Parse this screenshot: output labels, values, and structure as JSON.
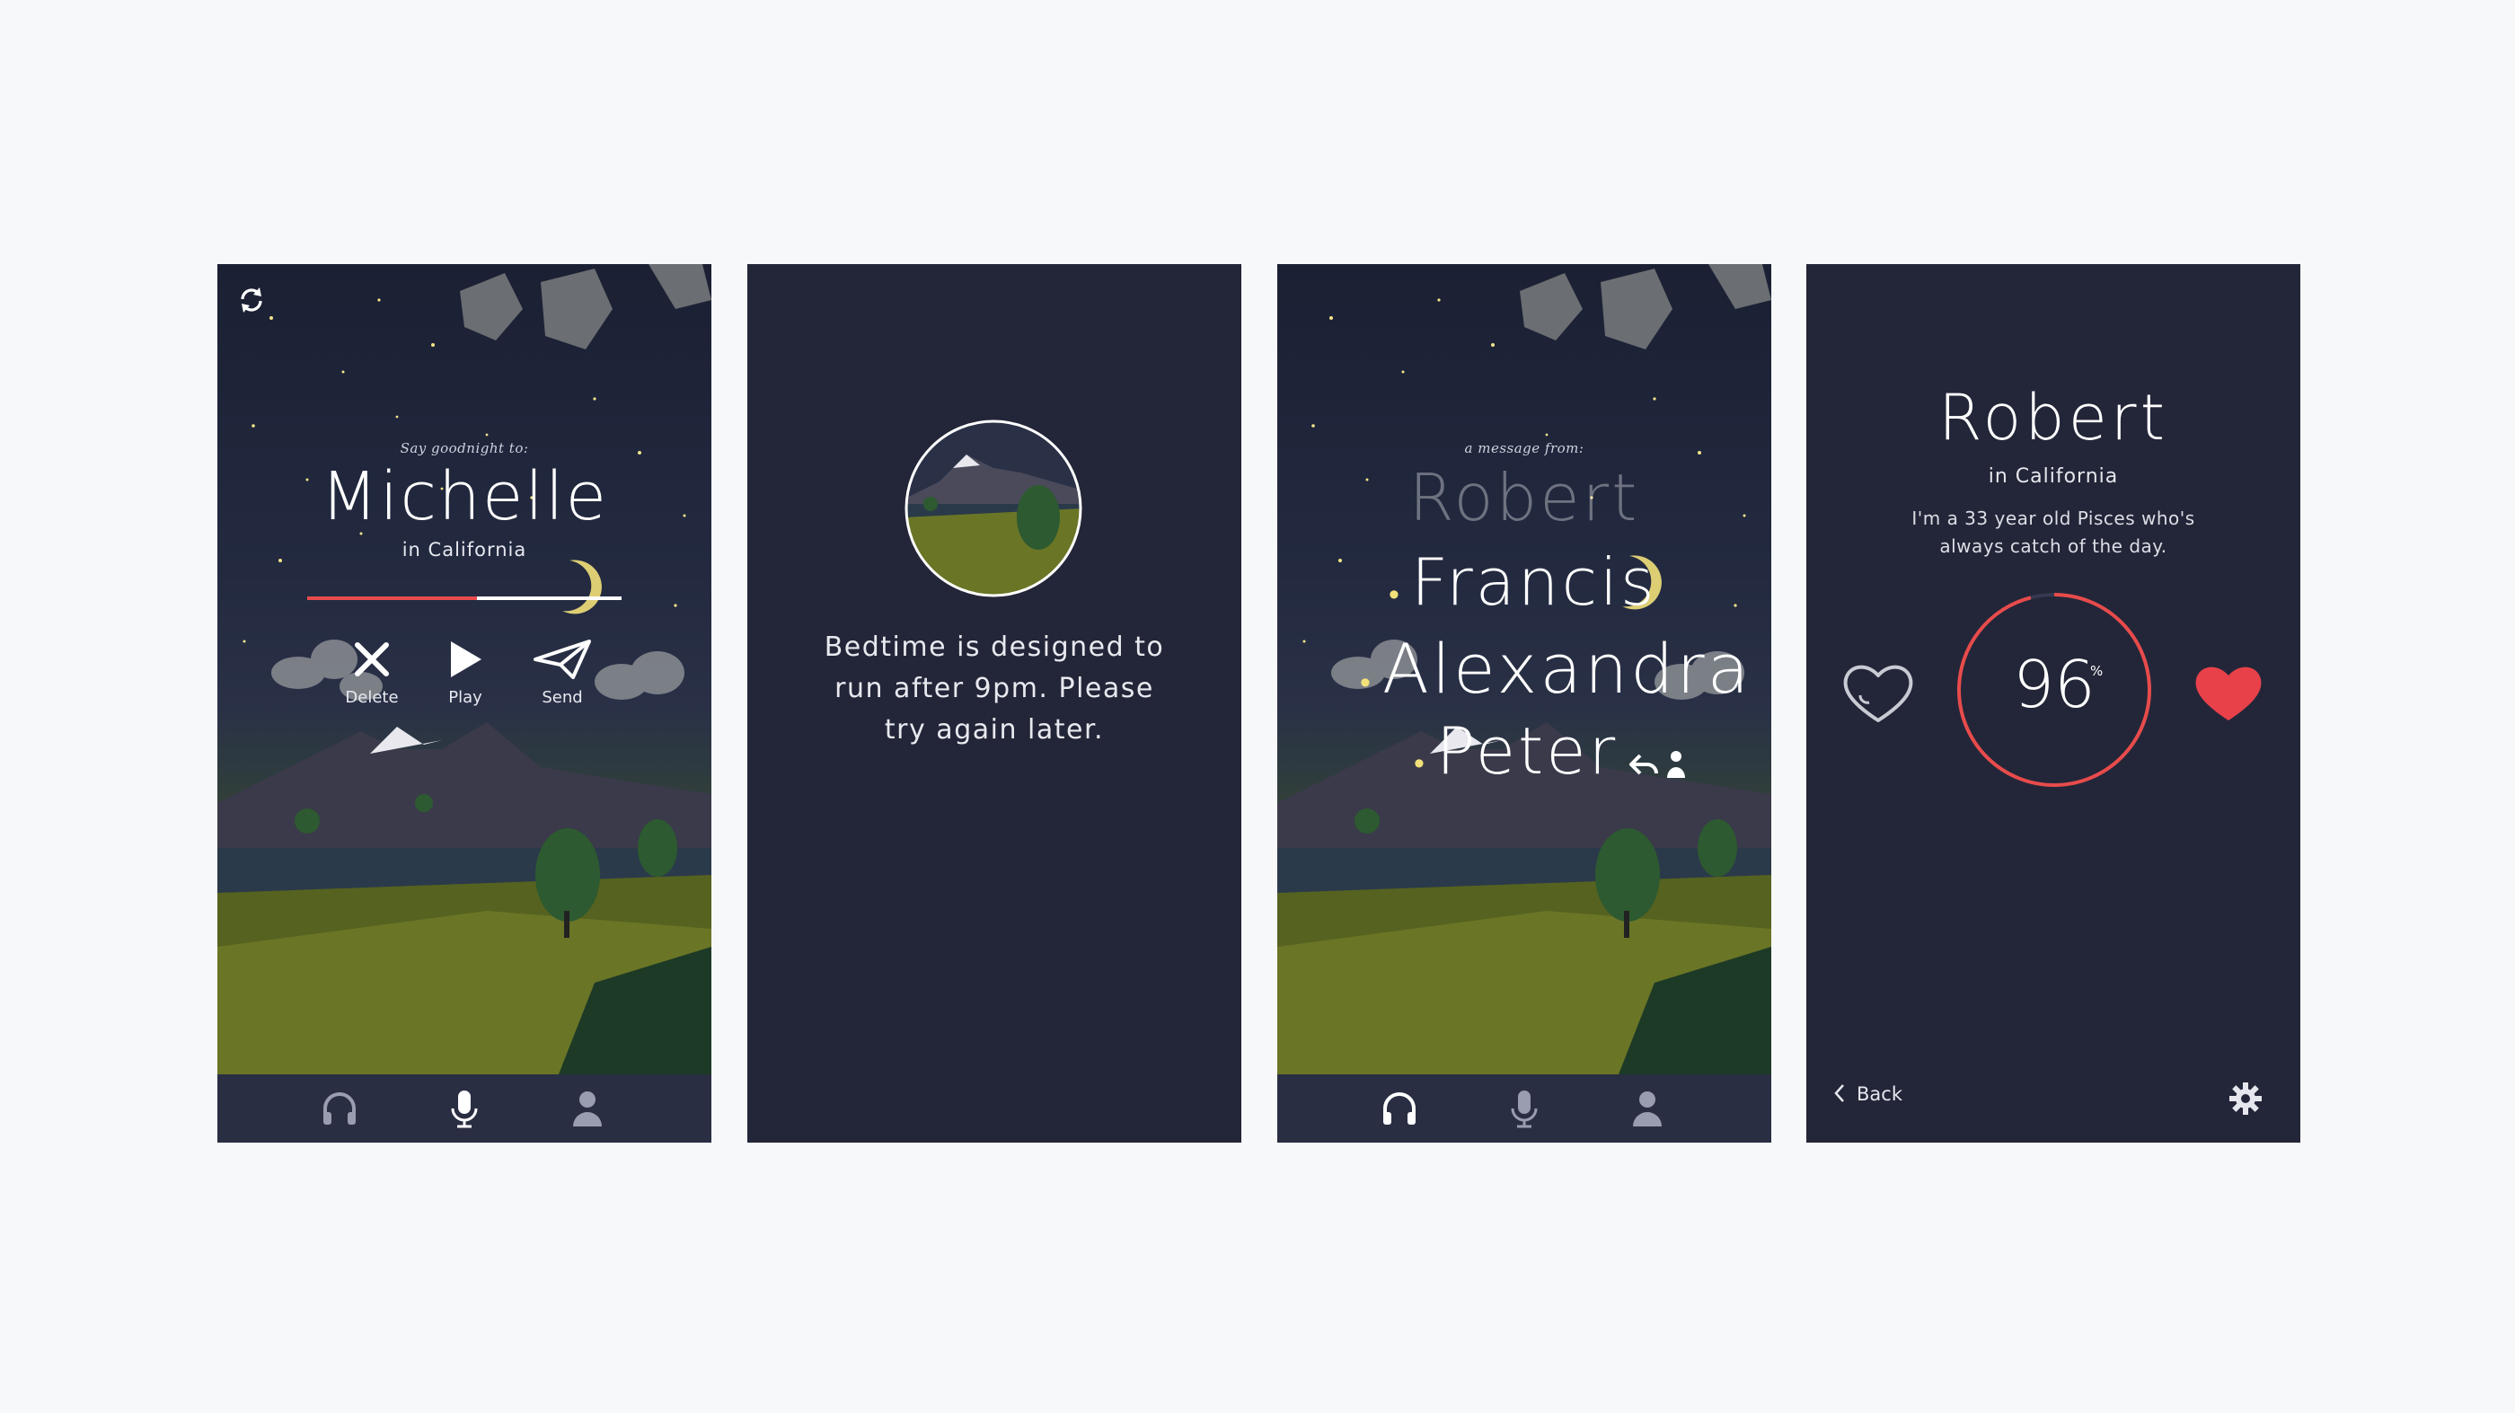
{
  "colors": {
    "page_bg": "#f7f8fa",
    "screen_bg": "#232638",
    "bar_bg": "#2a2e43",
    "accent_red": "#e84b4b",
    "moon_yellow": "#f2e07a"
  },
  "screen1": {
    "refresh_icon": "refresh-icon",
    "prompt": "Say goodnight to:",
    "name": "Michelle",
    "location": "in California",
    "recording_progress": 0.54,
    "actions": [
      {
        "label": "Delete",
        "icon": "close-icon"
      },
      {
        "label": "Play",
        "icon": "play-icon"
      },
      {
        "label": "Send",
        "icon": "paper-plane-icon"
      }
    ],
    "tabs": [
      {
        "icon": "headphones-icon",
        "active": false
      },
      {
        "icon": "microphone-icon",
        "active": true
      },
      {
        "icon": "person-icon",
        "active": false
      }
    ]
  },
  "screen2": {
    "message": [
      "Bedtime is designed to",
      "run after 9pm. Please",
      "try again later."
    ]
  },
  "screen3": {
    "prompt": "a message from:",
    "senders": [
      {
        "name": "Robert",
        "state": "faded"
      },
      {
        "name": "Francis",
        "state": "unread"
      },
      {
        "name": "Alexandra",
        "state": "unread"
      },
      {
        "name": "Peter",
        "state": "unread"
      }
    ],
    "tabs": [
      {
        "icon": "headphones-icon",
        "active": true
      },
      {
        "icon": "microphone-icon",
        "active": false
      },
      {
        "icon": "person-icon",
        "active": false
      }
    ]
  },
  "screen4": {
    "name": "Robert",
    "location": "in California",
    "bio": "I'm a 33 year old Pisces who's always catch of the day.",
    "score": "96",
    "score_unit": "%",
    "score_fraction": 0.96,
    "back_label": "Back"
  }
}
